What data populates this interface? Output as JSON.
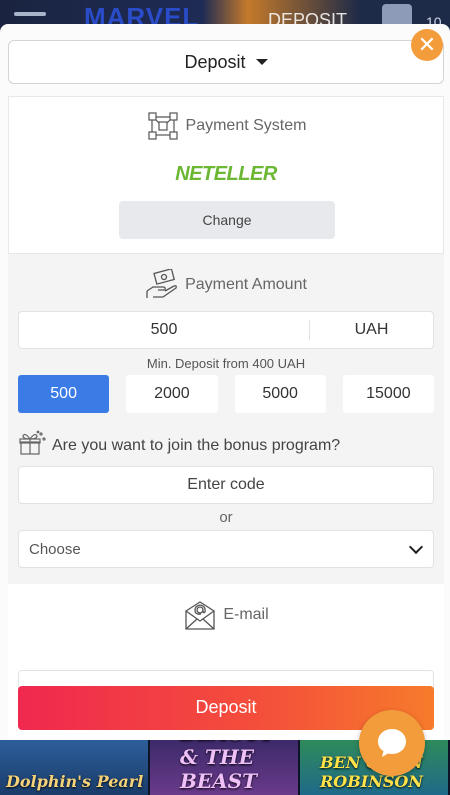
{
  "background": {
    "header_title": "MARVEL",
    "header_deposit": "DEPOSIT",
    "header_count": "10",
    "games": [
      "Dolphin's Pearl",
      "BEAUTY & THE BEAST",
      "BEN GUNN ROBINSON"
    ]
  },
  "modal": {
    "method_select": "Deposit",
    "payment_system": {
      "title": "Payment System",
      "provider": "NETELLER",
      "change_label": "Change"
    },
    "payment_amount": {
      "title": "Payment Amount",
      "amount": "500",
      "currency": "UAH",
      "min_deposit": "Min. Deposit from 400 UAH",
      "presets": [
        "500",
        "2000",
        "5000",
        "15000"
      ],
      "active_preset": "500"
    },
    "bonus": {
      "question": "Are you want to join the bonus program?",
      "code_placeholder": "Enter code",
      "or_label": "or",
      "choose_label": "Choose"
    },
    "email": {
      "title": "E-mail",
      "value": ""
    },
    "submit_label": "Deposit"
  },
  "colors": {
    "accent_orange": "#f39c3c",
    "primary_blue": "#3a7be6",
    "neteller_green": "#6cb733",
    "deposit_gradient_start": "#f0284f",
    "deposit_gradient_end": "#f77b2b"
  },
  "icons": {
    "close": "close-icon",
    "payment_system": "network-nodes-icon",
    "payment_amount": "hand-money-icon",
    "bonus": "gift-icon",
    "email": "envelope-at-icon",
    "chat": "chat-bubble-icon"
  }
}
